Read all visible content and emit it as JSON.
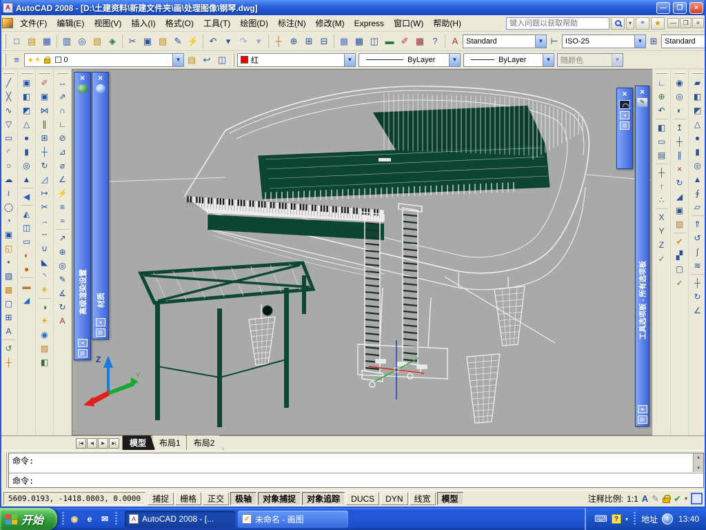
{
  "window": {
    "title": "AutoCAD 2008 - [D:\\土建资料\\新建文件夹\\画\\处理图像\\钢琴.dwg]",
    "controls": {
      "minimize": "—",
      "restore": "❐",
      "close": "×"
    }
  },
  "menubar": {
    "items": [
      {
        "n": "menu-file",
        "label": "文件(F)"
      },
      {
        "n": "menu-edit",
        "label": "编辑(E)"
      },
      {
        "n": "menu-view",
        "label": "视图(V)"
      },
      {
        "n": "menu-insert",
        "label": "插入(I)"
      },
      {
        "n": "menu-format",
        "label": "格式(O)"
      },
      {
        "n": "menu-tools",
        "label": "工具(T)"
      },
      {
        "n": "menu-draw",
        "label": "绘图(D)"
      },
      {
        "n": "menu-dimension",
        "label": "标注(N)"
      },
      {
        "n": "menu-modify",
        "label": "修改(M)"
      },
      {
        "n": "menu-express",
        "label": "Express"
      },
      {
        "n": "menu-window",
        "label": "窗口(W)"
      },
      {
        "n": "menu-help",
        "label": "帮助(H)"
      }
    ],
    "search_placeholder": "键入问题以获取帮助",
    "child_controls": {
      "minimize": "—",
      "restore": "❐",
      "close": "×"
    }
  },
  "toolbar_standard": {
    "icons": [
      {
        "n": "new-icon",
        "g": "□"
      },
      {
        "n": "open-icon",
        "g": "▤",
        "c": "#c09020"
      },
      {
        "n": "save-icon",
        "g": "▦",
        "c": "#2a5ac0"
      },
      {
        "sep": true
      },
      {
        "n": "plot-icon",
        "g": "▥"
      },
      {
        "n": "plot-preview-icon",
        "g": "◎"
      },
      {
        "n": "publish-icon",
        "g": "▧",
        "c": "#c09020"
      },
      {
        "n": "dwf-icon",
        "g": "◈",
        "c": "#2a7a3a"
      },
      {
        "sep": true
      },
      {
        "n": "cut-icon",
        "g": "✂"
      },
      {
        "n": "copy-icon",
        "g": "▣"
      },
      {
        "n": "paste-icon",
        "g": "▨",
        "c": "#c09020"
      },
      {
        "n": "match-properties-icon",
        "g": "✎"
      },
      {
        "n": "block-editor-icon",
        "g": "⚡",
        "c": "#d4a017"
      },
      {
        "sep": true
      },
      {
        "n": "undo-icon",
        "g": "↶"
      },
      {
        "n": "undo-dropdown-icon",
        "g": "▾"
      },
      {
        "n": "redo-icon",
        "g": "↷",
        "c": "#93a7cc"
      },
      {
        "n": "redo-dropdown-icon",
        "g": "▾",
        "c": "#93a7cc"
      },
      {
        "sep": true
      },
      {
        "n": "pan-icon",
        "g": "┼",
        "c": "#c07828"
      },
      {
        "n": "zoom-realtime-icon",
        "g": "⊕"
      },
      {
        "n": "zoom-window-icon",
        "g": "⊞"
      },
      {
        "n": "zoom-previous-icon",
        "g": "⊟"
      },
      {
        "sep": true
      },
      {
        "n": "properties-icon",
        "g": "▩",
        "c": "#5878c8"
      },
      {
        "n": "designcenter-icon",
        "g": "▦"
      },
      {
        "n": "tool-palettes-icon",
        "g": "◫"
      },
      {
        "n": "sheetset-icon",
        "g": "▬",
        "c": "#2a7a3a"
      },
      {
        "n": "markup-icon",
        "g": "✐",
        "c": "#c03030"
      },
      {
        "n": "quickcalc-icon",
        "g": "▦",
        "c": "#8a3030"
      },
      {
        "n": "help-icon",
        "g": "?",
        "c": "#2a5ac0"
      }
    ],
    "text_style_value": "Standard",
    "dim_style_value": "ISO-25",
    "table_style_value": "Standard"
  },
  "toolbar_layers": {
    "left_icons": [
      {
        "n": "layer-properties-icon",
        "g": "≡",
        "c": "#2a5ac0"
      }
    ],
    "layer_bulb_icon": "●",
    "layer_sun_icon": "☀",
    "layer_name": "0",
    "right_icons": [
      {
        "n": "layer-states-icon",
        "g": "▤",
        "c": "#c09020"
      },
      {
        "n": "layer-previous-icon",
        "g": "↩",
        "c": "#2a5ac0"
      },
      {
        "n": "layer-isolate-icon",
        "g": "◫",
        "c": "#2a5ac0"
      }
    ],
    "color_value": "红",
    "linetype_value": "ByLayer",
    "lineweight_value": "ByLayer",
    "plot_style_value": "随颜色"
  },
  "left_dock": {
    "col1": [
      {
        "n": "tool-line",
        "g": "╱"
      },
      {
        "n": "tool-construction-line",
        "g": "╳"
      },
      {
        "n": "tool-polyline",
        "g": "∿"
      },
      {
        "n": "tool-polygon",
        "g": "▽"
      },
      {
        "n": "tool-rectangle",
        "g": "▭"
      },
      {
        "n": "tool-arc",
        "g": "◜"
      },
      {
        "n": "tool-circle",
        "g": "○"
      },
      {
        "n": "tool-revision-cloud",
        "g": "☁"
      },
      {
        "n": "tool-spline",
        "g": "≀"
      },
      {
        "n": "tool-ellipse",
        "g": "◯"
      },
      {
        "n": "tool-ellipse-arc",
        "g": "◔"
      },
      {
        "n": "tool-insert-block",
        "g": "▣"
      },
      {
        "n": "tool-make-block",
        "g": "◱",
        "c": "#b08030"
      },
      {
        "n": "tool-point",
        "g": "•"
      },
      {
        "n": "tool-hatch",
        "g": "▨"
      },
      {
        "n": "tool-gradient",
        "g": "▩",
        "c": "#c08828"
      },
      {
        "n": "tool-region",
        "g": "▢"
      },
      {
        "n": "tool-table",
        "g": "⊞"
      },
      {
        "n": "tool-multiline-text",
        "g": "A"
      },
      {
        "sep": true
      },
      {
        "n": "tool-3d-orbit",
        "g": "↺",
        "c": "#2a7a3a"
      },
      {
        "n": "tool-pan",
        "g": "┼",
        "c": "#c07828"
      }
    ],
    "col2": [
      {
        "n": "tool-copy-object",
        "g": "▣"
      },
      {
        "n": "tool-box-3d",
        "g": "◧"
      },
      {
        "n": "tool-wedge-3d",
        "g": "◩"
      },
      {
        "n": "tool-cone-3d",
        "g": "△"
      },
      {
        "n": "tool-sphere-3d",
        "g": "●"
      },
      {
        "n": "tool-cylinder-3d",
        "g": "▮"
      },
      {
        "n": "tool-torus-3d",
        "g": "◎"
      },
      {
        "n": "tool-pyramid-3d",
        "g": "▲"
      },
      {
        "sep": true
      },
      {
        "n": "tool-previous-view",
        "g": "◀",
        "c": "#2a5ac0"
      },
      {
        "sep": true
      },
      {
        "n": "tool-visual-styles",
        "g": "◭"
      },
      {
        "n": "tool-3d-wireframe",
        "g": "◫"
      },
      {
        "n": "tool-3d-hidden",
        "g": "▭"
      },
      {
        "n": "tool-conceptual",
        "g": "◐",
        "c": "#b06820"
      },
      {
        "n": "tool-realistic",
        "g": "●",
        "c": "#c06818"
      },
      {
        "sep": true
      },
      {
        "n": "tool-distance",
        "g": "▬",
        "c": "#b08030"
      },
      {
        "n": "tool-area",
        "g": "◢",
        "c": "#2a6ac0"
      }
    ],
    "col3": [
      {
        "n": "tool-erase",
        "g": "✐",
        "c": "#b05050"
      },
      {
        "n": "tool-copy",
        "g": "▣"
      },
      {
        "n": "tool-mirror",
        "g": "⋈"
      },
      {
        "n": "tool-offset",
        "g": "∥"
      },
      {
        "n": "tool-array",
        "g": "⊞"
      },
      {
        "n": "tool-move",
        "g": "┼"
      },
      {
        "n": "tool-rotate",
        "g": "↻"
      },
      {
        "n": "tool-scale",
        "g": "◿"
      },
      {
        "n": "tool-stretch",
        "g": "↦"
      },
      {
        "n": "tool-trim",
        "g": "✂"
      },
      {
        "n": "tool-extend",
        "g": "→"
      },
      {
        "n": "tool-break",
        "g": "╌"
      },
      {
        "n": "tool-join",
        "g": "∪"
      },
      {
        "n": "tool-chamfer",
        "g": "◣"
      },
      {
        "n": "tool-fillet",
        "g": "◝"
      },
      {
        "n": "tool-explode",
        "g": "✳",
        "c": "#c0a020"
      },
      {
        "sep": true
      },
      {
        "n": "tool-render",
        "g": "◑",
        "c": "#3a6a3a"
      },
      {
        "n": "tool-lights",
        "g": "☀",
        "c": "#d8a010"
      },
      {
        "n": "tool-materials",
        "g": "◉",
        "c": "#2a6ac0"
      },
      {
        "n": "tool-mapping",
        "g": "▧",
        "c": "#b07828"
      },
      {
        "n": "tool-render-region",
        "g": "◧",
        "c": "#3a6a3a"
      }
    ],
    "col4": [
      {
        "n": "tool-dim-linear",
        "g": "↔"
      },
      {
        "n": "tool-dim-aligned",
        "g": "⇗"
      },
      {
        "n": "tool-dim-arc-length",
        "g": "∩"
      },
      {
        "n": "tool-dim-ordinate",
        "g": "∟"
      },
      {
        "n": "tool-dim-radius",
        "g": "⊘"
      },
      {
        "n": "tool-dim-jogged",
        "g": "⊿"
      },
      {
        "n": "tool-dim-diameter",
        "g": "⌀"
      },
      {
        "n": "tool-dim-angular",
        "g": "∠"
      },
      {
        "n": "tool-quick-dim",
        "g": "⚡",
        "c": "#c09020"
      },
      {
        "n": "tool-dim-baseline",
        "g": "≡"
      },
      {
        "n": "tool-dim-continue",
        "g": "≈"
      },
      {
        "sep": true
      },
      {
        "n": "tool-quick-leader",
        "g": "↗"
      },
      {
        "n": "tool-tolerance",
        "g": "⊕"
      },
      {
        "n": "tool-center-mark",
        "g": "◎"
      },
      {
        "n": "tool-dim-edit",
        "g": "✎"
      },
      {
        "n": "tool-dim-text-edit",
        "g": "∡"
      },
      {
        "n": "tool-dim-update",
        "g": "↻"
      },
      {
        "n": "tool-dim-style",
        "g": "A",
        "c": "#b03030"
      }
    ]
  },
  "right_dock": {
    "col1": [
      {
        "n": "tool-ucs",
        "g": "∟"
      },
      {
        "n": "tool-ucs-world",
        "g": "⊕",
        "c": "#2a7a3a"
      },
      {
        "n": "tool-ucs-previous",
        "g": "↶"
      },
      {
        "sep": true
      },
      {
        "n": "tool-ucs-face",
        "g": "◧"
      },
      {
        "n": "tool-ucs-object",
        "g": "▭"
      },
      {
        "n": "tool-ucs-view",
        "g": "▤"
      },
      {
        "sep": true
      },
      {
        "n": "tool-ucs-origin",
        "g": "┼"
      },
      {
        "n": "tool-ucs-z-axis",
        "g": "↑"
      },
      {
        "n": "tool-ucs-3point",
        "g": "∴"
      },
      {
        "sep": true
      },
      {
        "n": "tool-ucs-rotate-x",
        "g": "X"
      },
      {
        "n": "tool-ucs-rotate-y",
        "g": "Y"
      },
      {
        "n": "tool-ucs-rotate-z",
        "g": "Z"
      },
      {
        "n": "tool-ucs-apply",
        "g": "✓",
        "c": "#2a8a3a"
      }
    ],
    "col2": [
      {
        "n": "tool-union",
        "g": "◉"
      },
      {
        "n": "tool-subtract",
        "g": "◎"
      },
      {
        "n": "tool-intersect",
        "g": "◐"
      },
      {
        "sep": true
      },
      {
        "n": "tool-extrude-faces",
        "g": "↥"
      },
      {
        "n": "tool-move-faces",
        "g": "┼"
      },
      {
        "n": "tool-offset-faces",
        "g": "∥"
      },
      {
        "n": "tool-delete-faces",
        "g": "×",
        "c": "#c03030"
      },
      {
        "n": "tool-rotate-faces",
        "g": "↻"
      },
      {
        "n": "tool-taper-faces",
        "g": "◢"
      },
      {
        "n": "tool-copy-faces",
        "g": "▣"
      },
      {
        "n": "tool-color-faces",
        "g": "▨",
        "c": "#b07828"
      },
      {
        "sep": true
      },
      {
        "n": "tool-clean-solid",
        "g": "✔",
        "c": "#c09020"
      },
      {
        "n": "tool-separate-solid",
        "g": "▞"
      },
      {
        "n": "tool-shell-solid",
        "g": "▢"
      },
      {
        "n": "tool-check-solid",
        "g": "✓",
        "c": "#2a8a3a"
      }
    ],
    "col3": [
      {
        "n": "tool-polysolid",
        "g": "▰"
      },
      {
        "n": "tool-box",
        "g": "◧"
      },
      {
        "n": "tool-wedge",
        "g": "◩"
      },
      {
        "n": "tool-cone",
        "g": "△"
      },
      {
        "n": "tool-sphere",
        "g": "●"
      },
      {
        "n": "tool-cylinder",
        "g": "▮"
      },
      {
        "n": "tool-torus",
        "g": "◎"
      },
      {
        "n": "tool-pyramid",
        "g": "▲"
      },
      {
        "n": "tool-helix",
        "g": "∮"
      },
      {
        "n": "tool-planar-surface",
        "g": "▱"
      },
      {
        "sep": true
      },
      {
        "n": "tool-extrude",
        "g": "⇑"
      },
      {
        "n": "tool-revolve",
        "g": "↺"
      },
      {
        "n": "tool-sweep",
        "g": "∫"
      },
      {
        "n": "tool-loft",
        "g": "≋"
      },
      {
        "sep": true
      },
      {
        "n": "tool-3d-move",
        "g": "┼"
      },
      {
        "n": "tool-3d-rotate",
        "g": "↻"
      },
      {
        "n": "tool-3d-align",
        "g": "∠"
      }
    ]
  },
  "palettes": {
    "render_settings": {
      "title": "高级渲染设置",
      "close": "×"
    },
    "materials": {
      "title": "材质",
      "close": "×"
    },
    "dashboard": {
      "close": "×"
    },
    "tool_palettes": {
      "title": "工具选项板 - 所有选项板",
      "close": "×"
    }
  },
  "canvas": {
    "ucs_labels": {
      "z": "Z",
      "y": "Y"
    }
  },
  "tabs": {
    "nav": [
      "|◀",
      "◀",
      "▶",
      "▶|"
    ],
    "items": [
      {
        "n": "tab-model",
        "label": "模型",
        "active": true
      },
      {
        "n": "tab-layout1",
        "label": "布局1"
      },
      {
        "n": "tab-layout2",
        "label": "布局2"
      }
    ]
  },
  "command": {
    "history_line": "命令:",
    "input_line": "命令:"
  },
  "statusbar": {
    "coords": "5609.0193,  -1418.0803,  0.0000",
    "toggles": [
      {
        "n": "toggle-snap",
        "label": "捕捉"
      },
      {
        "n": "toggle-grid",
        "label": "栅格"
      },
      {
        "n": "toggle-ortho",
        "label": "正交"
      },
      {
        "n": "toggle-polar",
        "label": "极轴",
        "pressed": true
      },
      {
        "n": "toggle-osnap",
        "label": "对象捕捉",
        "pressed": true
      },
      {
        "n": "toggle-otrack",
        "label": "对象追踪",
        "pressed": true
      },
      {
        "n": "toggle-ducs",
        "label": "DUCS"
      },
      {
        "n": "toggle-dyn",
        "label": "DYN"
      },
      {
        "n": "toggle-lineweight",
        "label": "线宽"
      },
      {
        "n": "toggle-model",
        "label": "模型",
        "pressed": true
      }
    ],
    "annotation_label": "注释比例:",
    "annotation_value": "1:1",
    "dropdown_icon": "▾",
    "check_icon": "✔"
  },
  "taskbar": {
    "start_label": "开始",
    "quick_launch": [
      {
        "n": "media-player-icon",
        "g": "◉",
        "c": "#ffdd88"
      },
      {
        "n": "internet-explorer-icon",
        "g": "e",
        "c": "#ffffff"
      },
      {
        "n": "outlook-icon",
        "g": "✉",
        "c": "#ffffff"
      }
    ],
    "tasks": [
      {
        "label": "AutoCAD 2008 - [...",
        "active": true
      },
      {
        "label": "未命名 - 画图"
      }
    ],
    "tray_address_label": "地址",
    "keyboard_icon": "⌨",
    "help_badge": "?",
    "time": "13:40"
  }
}
